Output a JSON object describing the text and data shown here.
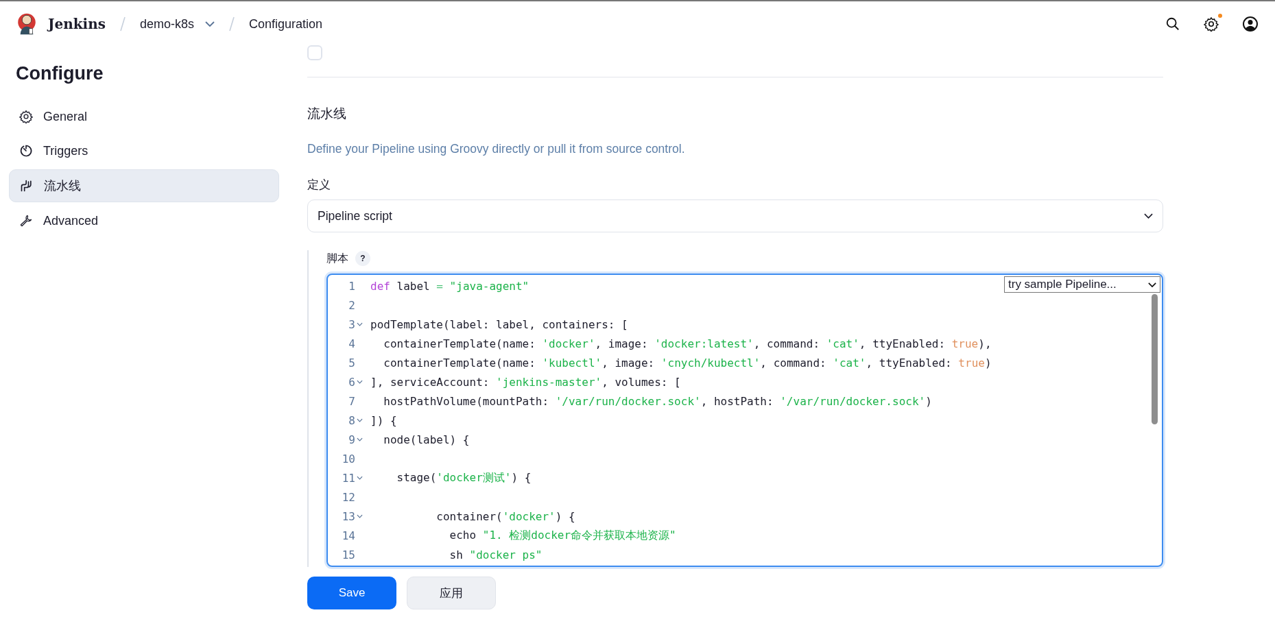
{
  "header": {
    "brand": "Jenkins",
    "breadcrumbs": [
      {
        "label": "demo-k8s",
        "dropdown": true
      },
      {
        "label": "Configuration",
        "dropdown": false
      }
    ],
    "notification": true
  },
  "sidebar": {
    "title": "Configure",
    "items": [
      {
        "label": "General",
        "selected": false
      },
      {
        "label": "Triggers",
        "selected": false
      },
      {
        "label": "流水线",
        "selected": true
      },
      {
        "label": "Advanced",
        "selected": false
      }
    ]
  },
  "partial_checkbox": {
    "checked": false
  },
  "section": {
    "title": "流水线",
    "description": "Define your Pipeline using Groovy directly or pull it from source control.",
    "definition_label": "定义",
    "definition_value": "Pipeline script",
    "script_label": "脚本",
    "help": "?",
    "sample_select": "try sample Pipeline...",
    "code": [
      {
        "number": "1",
        "foldable": false,
        "tokens": [
          {
            "kind": "keyword",
            "text": "def"
          },
          {
            "kind": "plain",
            "text": " label "
          },
          {
            "kind": "op",
            "text": "="
          },
          {
            "kind": "string",
            "text": " \"java-agent\""
          }
        ]
      },
      {
        "number": "2",
        "foldable": false
      },
      {
        "number": "3",
        "foldable": true,
        "tokens": [
          {
            "kind": "plain",
            "text": "podTemplate(label: label, containers: ["
          }
        ]
      },
      {
        "number": "4",
        "foldable": false,
        "tokens": [
          {
            "kind": "plain",
            "text": "  containerTemplate(name: "
          },
          {
            "kind": "string",
            "text": "'docker'"
          },
          {
            "kind": "plain",
            "text": ", image: "
          },
          {
            "kind": "string",
            "text": "'docker:latest'"
          },
          {
            "kind": "plain",
            "text": ", command: "
          },
          {
            "kind": "string",
            "text": "'cat'"
          },
          {
            "kind": "plain",
            "text": ", ttyEnabled: "
          },
          {
            "kind": "bool",
            "text": "true"
          },
          {
            "kind": "plain",
            "text": "),"
          }
        ]
      },
      {
        "number": "5",
        "foldable": false,
        "tokens": [
          {
            "kind": "plain",
            "text": "  containerTemplate(name: "
          },
          {
            "kind": "string",
            "text": "'kubectl'"
          },
          {
            "kind": "plain",
            "text": ", image: "
          },
          {
            "kind": "string",
            "text": "'cnych/kubectl'"
          },
          {
            "kind": "plain",
            "text": ", command: "
          },
          {
            "kind": "string",
            "text": "'cat'"
          },
          {
            "kind": "plain",
            "text": ", ttyEnabled: "
          },
          {
            "kind": "bool",
            "text": "true"
          },
          {
            "kind": "plain",
            "text": ")"
          }
        ]
      },
      {
        "number": "6",
        "foldable": true,
        "tokens": [
          {
            "kind": "plain",
            "text": "], serviceAccount: "
          },
          {
            "kind": "string",
            "text": "'jenkins-master'"
          },
          {
            "kind": "plain",
            "text": ", volumes: ["
          }
        ]
      },
      {
        "number": "7",
        "foldable": false,
        "tokens": [
          {
            "kind": "plain",
            "text": "  hostPathVolume(mountPath: "
          },
          {
            "kind": "string",
            "text": "'/var/run/docker.sock'"
          },
          {
            "kind": "plain",
            "text": ", hostPath: "
          },
          {
            "kind": "string",
            "text": "'/var/run/docker.sock'"
          },
          {
            "kind": "plain",
            "text": ")"
          }
        ]
      },
      {
        "number": "8",
        "foldable": true,
        "tokens": [
          {
            "kind": "plain",
            "text": "]) {"
          }
        ]
      },
      {
        "number": "9",
        "foldable": true,
        "tokens": [
          {
            "kind": "plain",
            "text": "  node(label) {"
          }
        ]
      },
      {
        "number": "10",
        "foldable": false
      },
      {
        "number": "11",
        "foldable": true,
        "tokens": [
          {
            "kind": "plain",
            "text": "    stage("
          },
          {
            "kind": "string",
            "text": "'docker测试'"
          },
          {
            "kind": "plain",
            "text": ") {"
          }
        ]
      },
      {
        "number": "12",
        "foldable": false
      },
      {
        "number": "13",
        "foldable": true,
        "tokens": [
          {
            "kind": "plain",
            "text": "          container("
          },
          {
            "kind": "string",
            "text": "'docker'"
          },
          {
            "kind": "plain",
            "text": ") {"
          }
        ]
      },
      {
        "number": "14",
        "foldable": false,
        "tokens": [
          {
            "kind": "plain",
            "text": "            echo "
          },
          {
            "kind": "string",
            "text": "\"1. 检测docker命令并获取本地资源\""
          }
        ]
      },
      {
        "number": "15",
        "foldable": false,
        "tokens": [
          {
            "kind": "plain",
            "text": "            sh "
          },
          {
            "kind": "string",
            "text": "\"docker ps\""
          }
        ]
      }
    ]
  },
  "buttons": [
    {
      "label": "Save",
      "kind": "primary"
    },
    {
      "label": "应用",
      "kind": "secondary"
    }
  ]
}
